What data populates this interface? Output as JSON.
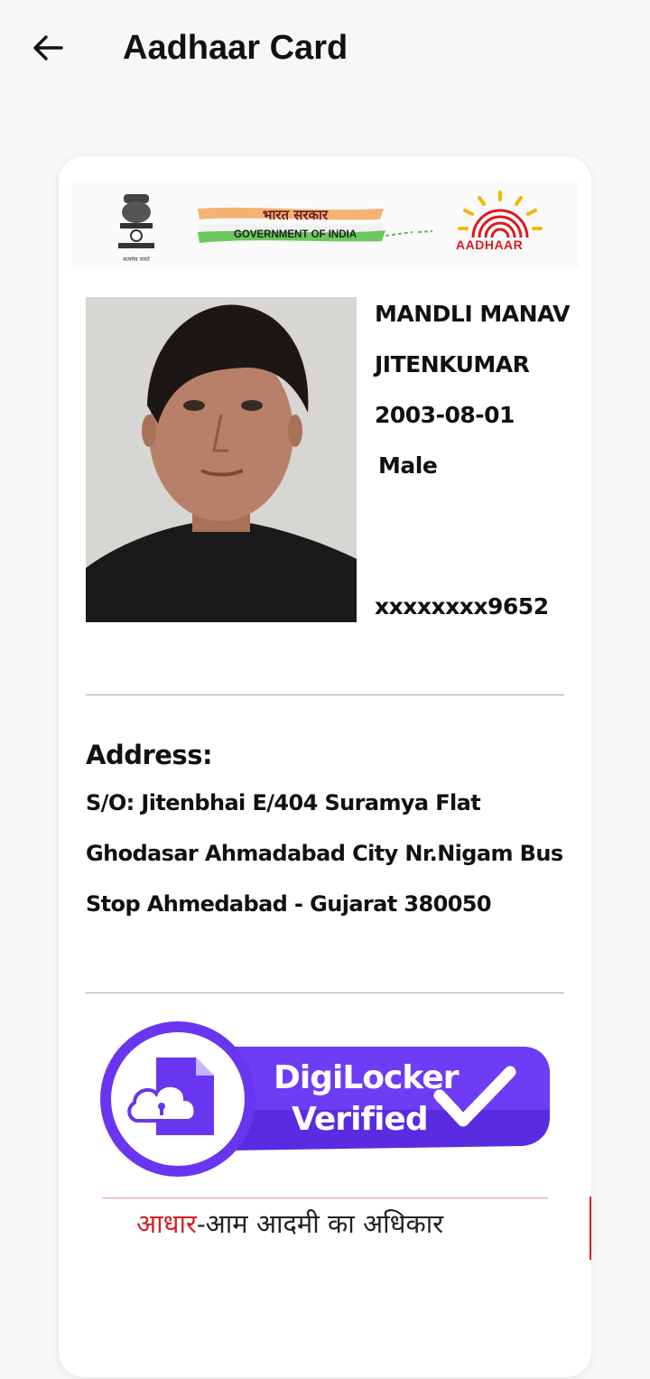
{
  "appbar": {
    "title": "Aadhaar Card"
  },
  "banner": {
    "gov_hindi": "भारत सरकार",
    "gov_english": "GOVERNMENT OF INDIA",
    "emblem_caption": "सत्यमेव जयते",
    "aadhaar_logo_text": "AADHAAR"
  },
  "holder": {
    "name_line1": "MANDLI MANAV",
    "name_line2": "JITENKUMAR",
    "dob": "2003-08-01",
    "gender": "Male",
    "uid_masked": "xxxxxxxx9652"
  },
  "address": {
    "heading": "Address:",
    "line1": "S/O: Jitenbhai E/404 Suramya Flat",
    "line2": "Ghodasar Ahmadabad City Nr.Nigam Bus",
    "line3": "Stop Ahmedabad - Gujarat 380050"
  },
  "digilocker": {
    "line1": "DigiLocker",
    "line2": "Verified"
  },
  "tagline": {
    "red_part": "आधार",
    "rest": "-आम आदमी का अधिकार"
  },
  "colors": {
    "accent_purple": "#6a35f0",
    "aadhaar_red": "#d81b22",
    "aadhaar_yellow": "#f5b400"
  },
  "icons": [
    "back-arrow-icon",
    "emblem-icon",
    "aadhaar-logo-icon",
    "cloud-lock-document-icon",
    "checkmark-icon"
  ]
}
